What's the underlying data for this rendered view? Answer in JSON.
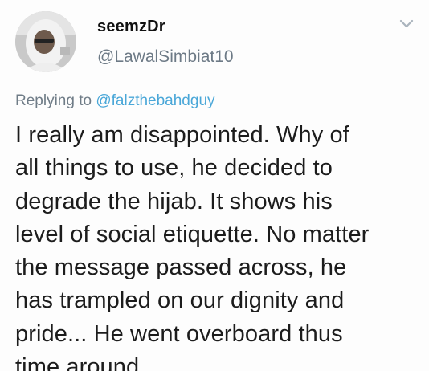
{
  "tweet": {
    "display_name": "seemzDr",
    "handle": "@LawalSimbiat10",
    "replying_prefix": "Replying to",
    "replying_to": "@falzthebahdguy",
    "text": "I really am disappointed. Why of\nall things to use, he decided to\ndegrade the hijab. It shows his\nlevel of social etiquette. No matter\nthe message passed across, he\nhas trampled on our dignity and\npride... He went overboard thus\ntime around."
  },
  "icons": {
    "avatar": "profile-photo",
    "menu": "chevron-down-icon"
  },
  "colors": {
    "mention": "#4aa7d8",
    "secondary_text": "#6d7a86",
    "body_text": "#1c1c1c",
    "background": "#fdfdfd"
  }
}
